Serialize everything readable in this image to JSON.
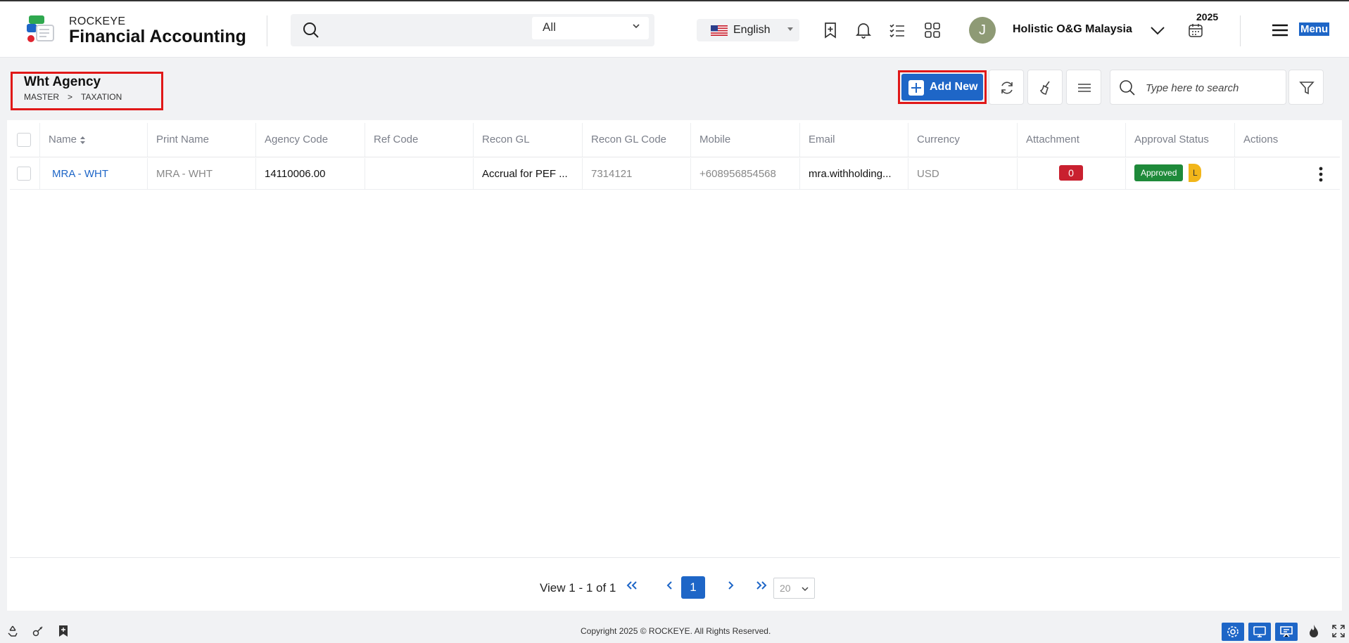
{
  "header": {
    "brand_small": "ROCKEYE",
    "brand_big": "Financial Accounting",
    "search_scope": "All",
    "language": "English",
    "avatar_initial": "J",
    "company": "Holistic O&G Malaysia",
    "year": "2025",
    "menu_label": "Menu"
  },
  "page": {
    "title": "Wht Agency",
    "breadcrumb": [
      "MASTER",
      ">",
      "TAXATION"
    ]
  },
  "toolbar": {
    "add_new_label": "Add New",
    "search_placeholder": "Type here to search"
  },
  "table": {
    "columns": [
      "Name",
      "Print Name",
      "Agency Code",
      "Ref Code",
      "Recon GL",
      "Recon GL Code",
      "Mobile",
      "Email",
      "Currency",
      "Attachment",
      "Approval Status",
      "Actions"
    ],
    "rows": [
      {
        "name": "MRA - WHT",
        "print_name": "MRA - WHT",
        "agency_code": "14110006.00",
        "ref_code": "",
        "recon_gl": "Accrual for PEF ...",
        "recon_gl_code": "7314121",
        "mobile": "+608956854568",
        "email": "mra.withholding...",
        "currency": "USD",
        "attachment": "0",
        "approval_status": "Approved",
        "level_badge": "L"
      }
    ]
  },
  "pagination": {
    "view_text": "View 1 - 1 of 1",
    "current_page": "1",
    "page_size": "20"
  },
  "footer": {
    "copyright": "Copyright 2025 © ROCKEYE. All Rights Reserved."
  },
  "colors": {
    "primary": "#1e66c7",
    "highlight_border": "#e01818",
    "approved": "#1e8a3a",
    "attachment_badge": "#c9202f",
    "level_badge": "#f2b61a"
  }
}
